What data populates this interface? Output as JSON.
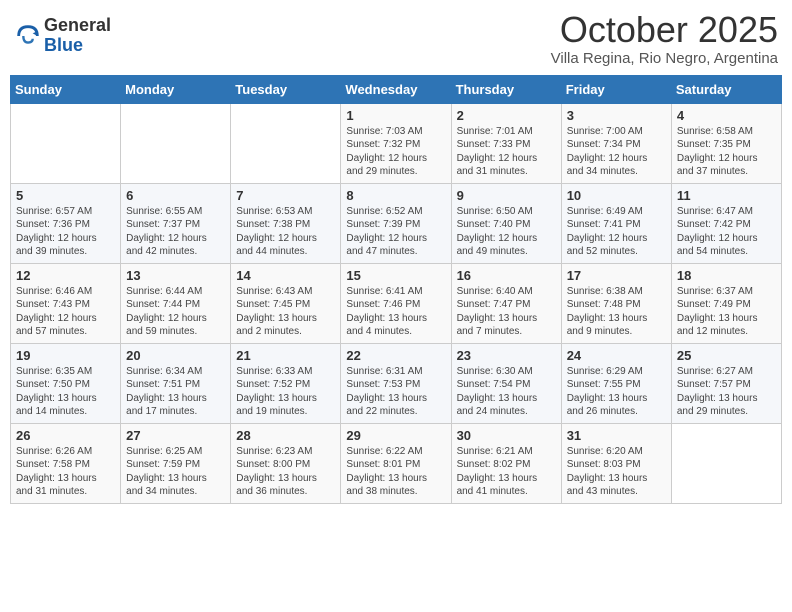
{
  "header": {
    "logo_general": "General",
    "logo_blue": "Blue",
    "month_title": "October 2025",
    "location": "Villa Regina, Rio Negro, Argentina"
  },
  "calendar": {
    "days_of_week": [
      "Sunday",
      "Monday",
      "Tuesday",
      "Wednesday",
      "Thursday",
      "Friday",
      "Saturday"
    ],
    "weeks": [
      [
        {
          "day": "",
          "info": ""
        },
        {
          "day": "",
          "info": ""
        },
        {
          "day": "",
          "info": ""
        },
        {
          "day": "1",
          "info": "Sunrise: 7:03 AM\nSunset: 7:32 PM\nDaylight: 12 hours\nand 29 minutes."
        },
        {
          "day": "2",
          "info": "Sunrise: 7:01 AM\nSunset: 7:33 PM\nDaylight: 12 hours\nand 31 minutes."
        },
        {
          "day": "3",
          "info": "Sunrise: 7:00 AM\nSunset: 7:34 PM\nDaylight: 12 hours\nand 34 minutes."
        },
        {
          "day": "4",
          "info": "Sunrise: 6:58 AM\nSunset: 7:35 PM\nDaylight: 12 hours\nand 37 minutes."
        }
      ],
      [
        {
          "day": "5",
          "info": "Sunrise: 6:57 AM\nSunset: 7:36 PM\nDaylight: 12 hours\nand 39 minutes."
        },
        {
          "day": "6",
          "info": "Sunrise: 6:55 AM\nSunset: 7:37 PM\nDaylight: 12 hours\nand 42 minutes."
        },
        {
          "day": "7",
          "info": "Sunrise: 6:53 AM\nSunset: 7:38 PM\nDaylight: 12 hours\nand 44 minutes."
        },
        {
          "day": "8",
          "info": "Sunrise: 6:52 AM\nSunset: 7:39 PM\nDaylight: 12 hours\nand 47 minutes."
        },
        {
          "day": "9",
          "info": "Sunrise: 6:50 AM\nSunset: 7:40 PM\nDaylight: 12 hours\nand 49 minutes."
        },
        {
          "day": "10",
          "info": "Sunrise: 6:49 AM\nSunset: 7:41 PM\nDaylight: 12 hours\nand 52 minutes."
        },
        {
          "day": "11",
          "info": "Sunrise: 6:47 AM\nSunset: 7:42 PM\nDaylight: 12 hours\nand 54 minutes."
        }
      ],
      [
        {
          "day": "12",
          "info": "Sunrise: 6:46 AM\nSunset: 7:43 PM\nDaylight: 12 hours\nand 57 minutes."
        },
        {
          "day": "13",
          "info": "Sunrise: 6:44 AM\nSunset: 7:44 PM\nDaylight: 12 hours\nand 59 minutes."
        },
        {
          "day": "14",
          "info": "Sunrise: 6:43 AM\nSunset: 7:45 PM\nDaylight: 13 hours\nand 2 minutes."
        },
        {
          "day": "15",
          "info": "Sunrise: 6:41 AM\nSunset: 7:46 PM\nDaylight: 13 hours\nand 4 minutes."
        },
        {
          "day": "16",
          "info": "Sunrise: 6:40 AM\nSunset: 7:47 PM\nDaylight: 13 hours\nand 7 minutes."
        },
        {
          "day": "17",
          "info": "Sunrise: 6:38 AM\nSunset: 7:48 PM\nDaylight: 13 hours\nand 9 minutes."
        },
        {
          "day": "18",
          "info": "Sunrise: 6:37 AM\nSunset: 7:49 PM\nDaylight: 13 hours\nand 12 minutes."
        }
      ],
      [
        {
          "day": "19",
          "info": "Sunrise: 6:35 AM\nSunset: 7:50 PM\nDaylight: 13 hours\nand 14 minutes."
        },
        {
          "day": "20",
          "info": "Sunrise: 6:34 AM\nSunset: 7:51 PM\nDaylight: 13 hours\nand 17 minutes."
        },
        {
          "day": "21",
          "info": "Sunrise: 6:33 AM\nSunset: 7:52 PM\nDaylight: 13 hours\nand 19 minutes."
        },
        {
          "day": "22",
          "info": "Sunrise: 6:31 AM\nSunset: 7:53 PM\nDaylight: 13 hours\nand 22 minutes."
        },
        {
          "day": "23",
          "info": "Sunrise: 6:30 AM\nSunset: 7:54 PM\nDaylight: 13 hours\nand 24 minutes."
        },
        {
          "day": "24",
          "info": "Sunrise: 6:29 AM\nSunset: 7:55 PM\nDaylight: 13 hours\nand 26 minutes."
        },
        {
          "day": "25",
          "info": "Sunrise: 6:27 AM\nSunset: 7:57 PM\nDaylight: 13 hours\nand 29 minutes."
        }
      ],
      [
        {
          "day": "26",
          "info": "Sunrise: 6:26 AM\nSunset: 7:58 PM\nDaylight: 13 hours\nand 31 minutes."
        },
        {
          "day": "27",
          "info": "Sunrise: 6:25 AM\nSunset: 7:59 PM\nDaylight: 13 hours\nand 34 minutes."
        },
        {
          "day": "28",
          "info": "Sunrise: 6:23 AM\nSunset: 8:00 PM\nDaylight: 13 hours\nand 36 minutes."
        },
        {
          "day": "29",
          "info": "Sunrise: 6:22 AM\nSunset: 8:01 PM\nDaylight: 13 hours\nand 38 minutes."
        },
        {
          "day": "30",
          "info": "Sunrise: 6:21 AM\nSunset: 8:02 PM\nDaylight: 13 hours\nand 41 minutes."
        },
        {
          "day": "31",
          "info": "Sunrise: 6:20 AM\nSunset: 8:03 PM\nDaylight: 13 hours\nand 43 minutes."
        },
        {
          "day": "",
          "info": ""
        }
      ]
    ]
  }
}
